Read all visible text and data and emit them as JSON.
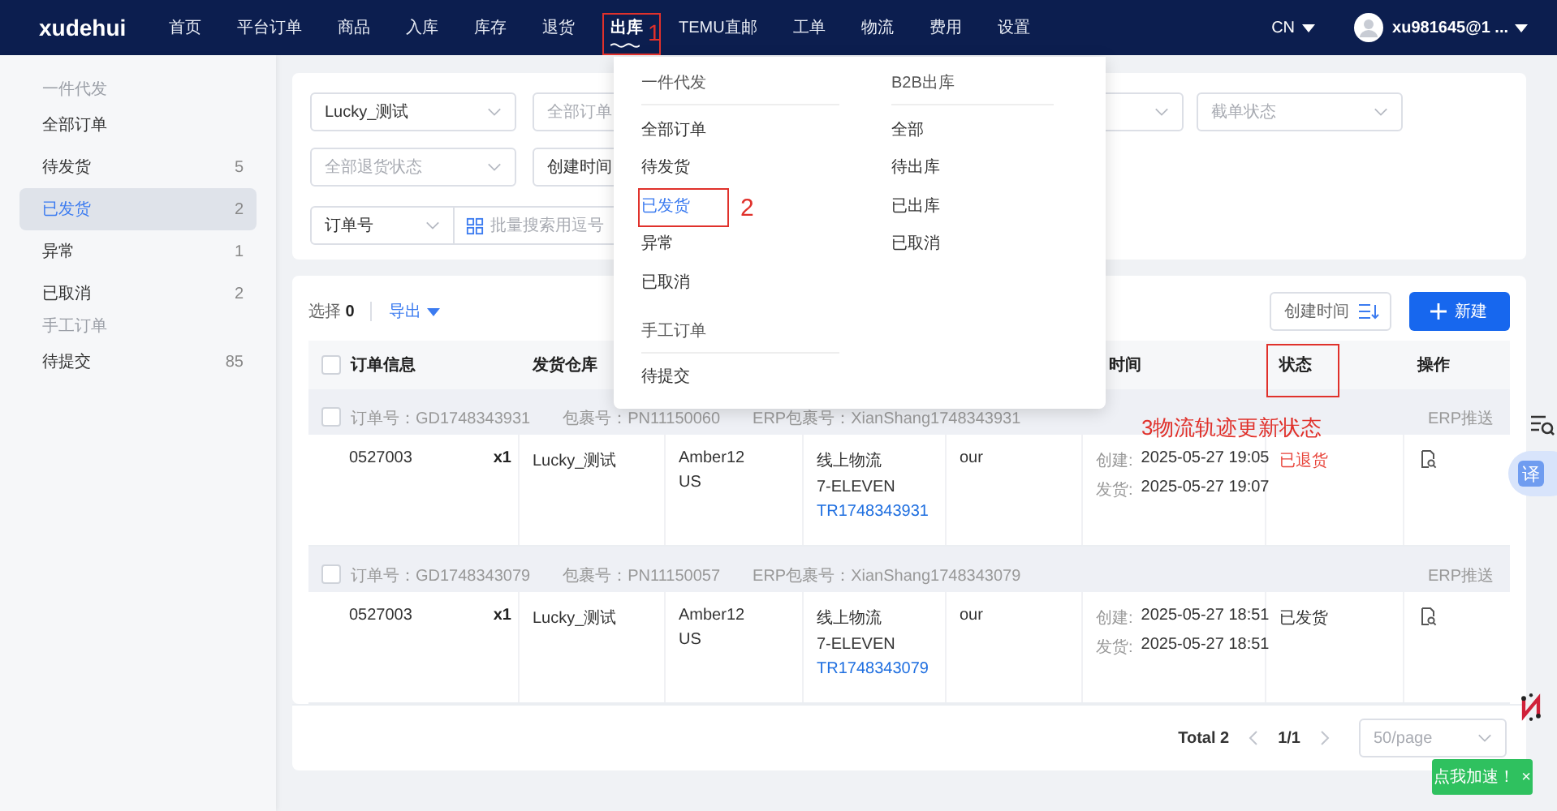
{
  "topbar": {
    "logo": "xudehui",
    "nav": [
      {
        "label": "首页",
        "selected": false
      },
      {
        "label": "平台订单",
        "selected": false
      },
      {
        "label": "商品",
        "selected": false
      },
      {
        "label": "入库",
        "selected": false
      },
      {
        "label": "库存",
        "selected": false
      },
      {
        "label": "退货",
        "selected": false
      },
      {
        "label": "出库",
        "selected": true
      },
      {
        "label": "TEMU直邮",
        "selected": false
      },
      {
        "label": "工单",
        "selected": false
      },
      {
        "label": "物流",
        "selected": false
      },
      {
        "label": "费用",
        "selected": false
      },
      {
        "label": "设置",
        "selected": false
      }
    ],
    "language": "CN",
    "user": "xu981645@1 ..."
  },
  "sidebar": {
    "items": [
      {
        "kind": "section",
        "label": "一件代发"
      },
      {
        "kind": "item",
        "label": "全部订单",
        "selected": false
      },
      {
        "kind": "item",
        "label": "待发货",
        "count": "5",
        "selected": false
      },
      {
        "kind": "item",
        "label": "已发货",
        "count": "2",
        "selected": true
      },
      {
        "kind": "item",
        "label": "异常",
        "count": "1",
        "selected": false
      },
      {
        "kind": "item",
        "label": "已取消",
        "count": "2",
        "selected": false
      },
      {
        "kind": "section",
        "label": "手工订单"
      },
      {
        "kind": "item",
        "label": "待提交",
        "count": "85",
        "selected": false
      }
    ]
  },
  "filters": [
    [
      {
        "kind": "select",
        "value": "Lucky_测试"
      },
      {
        "kind": "text",
        "placeholder": "全部订单"
      },
      {
        "kind": "hidden"
      },
      {
        "kind": "select"
      },
      {
        "kind": "select",
        "placeholder": "截单状态"
      }
    ],
    [
      {
        "kind": "select",
        "placeholder": "全部退货状态"
      },
      {
        "kind": "date",
        "value": "创建时间"
      }
    ],
    [
      {
        "kind": "search",
        "value": "订单号",
        "placeholder": "批量搜索用逗号"
      }
    ]
  ],
  "toolbar": {
    "selected_label": "选择",
    "selected_count": "0",
    "export": "导出",
    "sort": "创建时间",
    "new": "新建"
  },
  "table": {
    "select_all_checked": false,
    "columns": [
      {
        "label": "订单信息"
      },
      {
        "label": "发货仓库"
      },
      {},
      {},
      {},
      {
        "label": "时间"
      },
      {
        "label": "状态"
      },
      {
        "label": "操作"
      }
    ],
    "orders": [
      {
        "checked": false,
        "order_no": "订单号：GD1748343931",
        "package_no": "包裹号：PN11150060",
        "erp_no": "ERP包裹号：XianShang1748343931",
        "erp_push": "ERP推送",
        "sku": "0527003",
        "qty": "x1",
        "warehouse": "Lucky_测试",
        "recipient": [
          "Amber12",
          "US"
        ],
        "logistics": [
          "线上物流",
          "7-ELEVEN"
        ],
        "tracking": "TR1748343931",
        "column_6": "our",
        "created_label": "创建:",
        "created": "2025-05-27 19:05",
        "shipped_label": "发货:",
        "shipped": "2025-05-27 19:07",
        "status": "已退货",
        "color": "#e8463c"
      },
      {
        "checked": false,
        "order_no": "订单号：GD1748343079",
        "package_no": "包裹号：PN11150057",
        "erp_no": "ERP包裹号：XianShang1748343079",
        "erp_push": "ERP推送",
        "sku": "0527003",
        "qty": "x1",
        "warehouse": "Lucky_测试",
        "recipient": [
          "Amber12",
          "US"
        ],
        "logistics": [
          "线上物流",
          "7-ELEVEN"
        ],
        "tracking": "TR1748343079",
        "column_6": "our",
        "created_label": "创建:",
        "created": "2025-05-27 18:51",
        "shipped_label": "发货:",
        "shipped": "2025-05-27 18:51",
        "status": "已发货",
        "color": "#333333"
      }
    ]
  },
  "pagination": {
    "total": "Total 2",
    "page": "1/1",
    "page_size": "50/page"
  },
  "menu": {
    "columns": [
      [
        {
          "title": "一件代发",
          "items": [
            {
              "label": "全部订单",
              "selected": false
            },
            {
              "label": "待发货",
              "selected": false
            },
            {
              "label": "已发货",
              "selected": true
            },
            {
              "label": "异常",
              "selected": false
            },
            {
              "label": "已取消",
              "selected": false
            }
          ]
        },
        {
          "title": "手工订单",
          "items": [
            {
              "label": "待提交",
              "selected": false
            }
          ]
        }
      ],
      [
        {
          "title": "B2B出库",
          "items": [
            {
              "label": "全部",
              "selected": false
            },
            {
              "label": "待出库",
              "selected": false
            },
            {
              "label": "已出库",
              "selected": false
            },
            {
              "label": "已取消",
              "selected": false
            }
          ]
        }
      ]
    ]
  },
  "annotations": [
    {
      "kind": "nav",
      "text": "1"
    },
    {
      "kind": "menu",
      "text": "2"
    },
    {
      "kind": "status",
      "text": "3物流轨迹更新状态"
    }
  ],
  "widgets": {
    "translate": "译",
    "toast": "点我加速！",
    "toast_close": "×"
  }
}
